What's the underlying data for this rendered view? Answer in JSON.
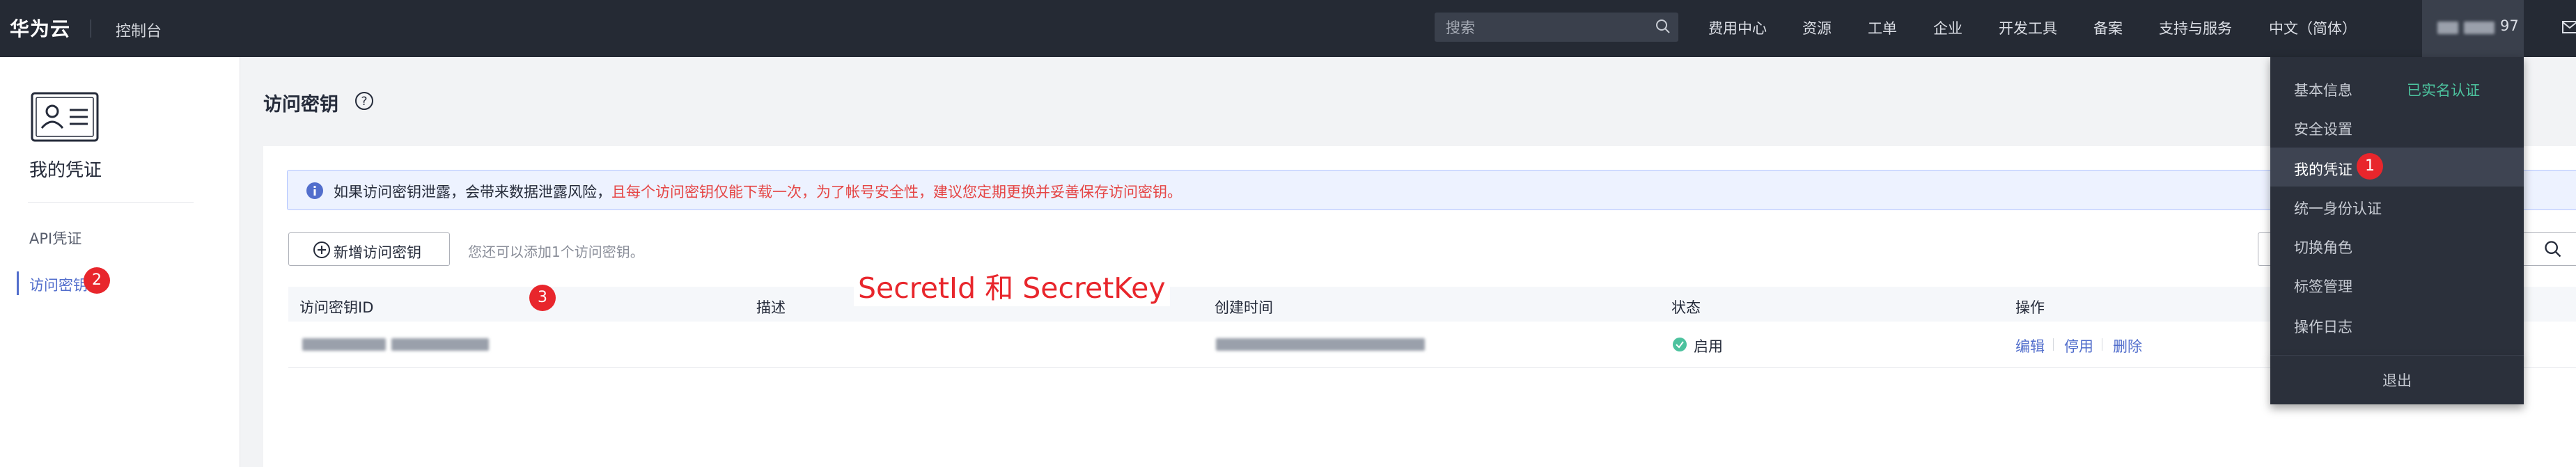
{
  "topbar": {
    "logo": "华为云",
    "console": "控制台",
    "search_placeholder": "搜索",
    "nav": [
      "费用中心",
      "资源",
      "工单",
      "企业",
      "开发工具",
      "备案",
      "支持与服务",
      "中文（简体）"
    ],
    "user_suffix": "97"
  },
  "sidebar": {
    "title": "我的凭证",
    "items": [
      {
        "label": "API凭证"
      },
      {
        "label": "访问密钥"
      }
    ]
  },
  "main": {
    "title": "访问密钥",
    "alert": {
      "normal": "如果访问密钥泄露，会带来数据泄露风险，",
      "warning": "且每个访问密钥仅能下载一次，为了帐号安全性，建议您定期更换并妥善保存访问密钥。"
    },
    "add_button": "新增访问密钥",
    "hint": "您还可以添加1个访问密钥。",
    "table": {
      "headers": [
        "访问密钥ID",
        "描述",
        "创建时间",
        "状态",
        "操作"
      ],
      "rows": [
        {
          "status": "启用",
          "ops": [
            "编辑",
            "停用",
            "删除"
          ]
        }
      ]
    }
  },
  "annotation": {
    "text": "SecretId 和 SecretKey",
    "badges": [
      "1",
      "2",
      "3"
    ]
  },
  "dropdown": {
    "items": [
      {
        "label": "基本信息",
        "badge": "已实名认证"
      },
      {
        "label": "安全设置"
      },
      {
        "label": "我的凭证"
      },
      {
        "label": "统一身份认证"
      },
      {
        "label": "切换角色"
      },
      {
        "label": "标签管理"
      },
      {
        "label": "操作日志"
      }
    ],
    "logout": "退出"
  },
  "colors": {
    "topbar": "#252a34",
    "accent": "#526ecc",
    "warning": "#e54545",
    "annotation": "#e8262c",
    "verified": "#4cc29e"
  }
}
